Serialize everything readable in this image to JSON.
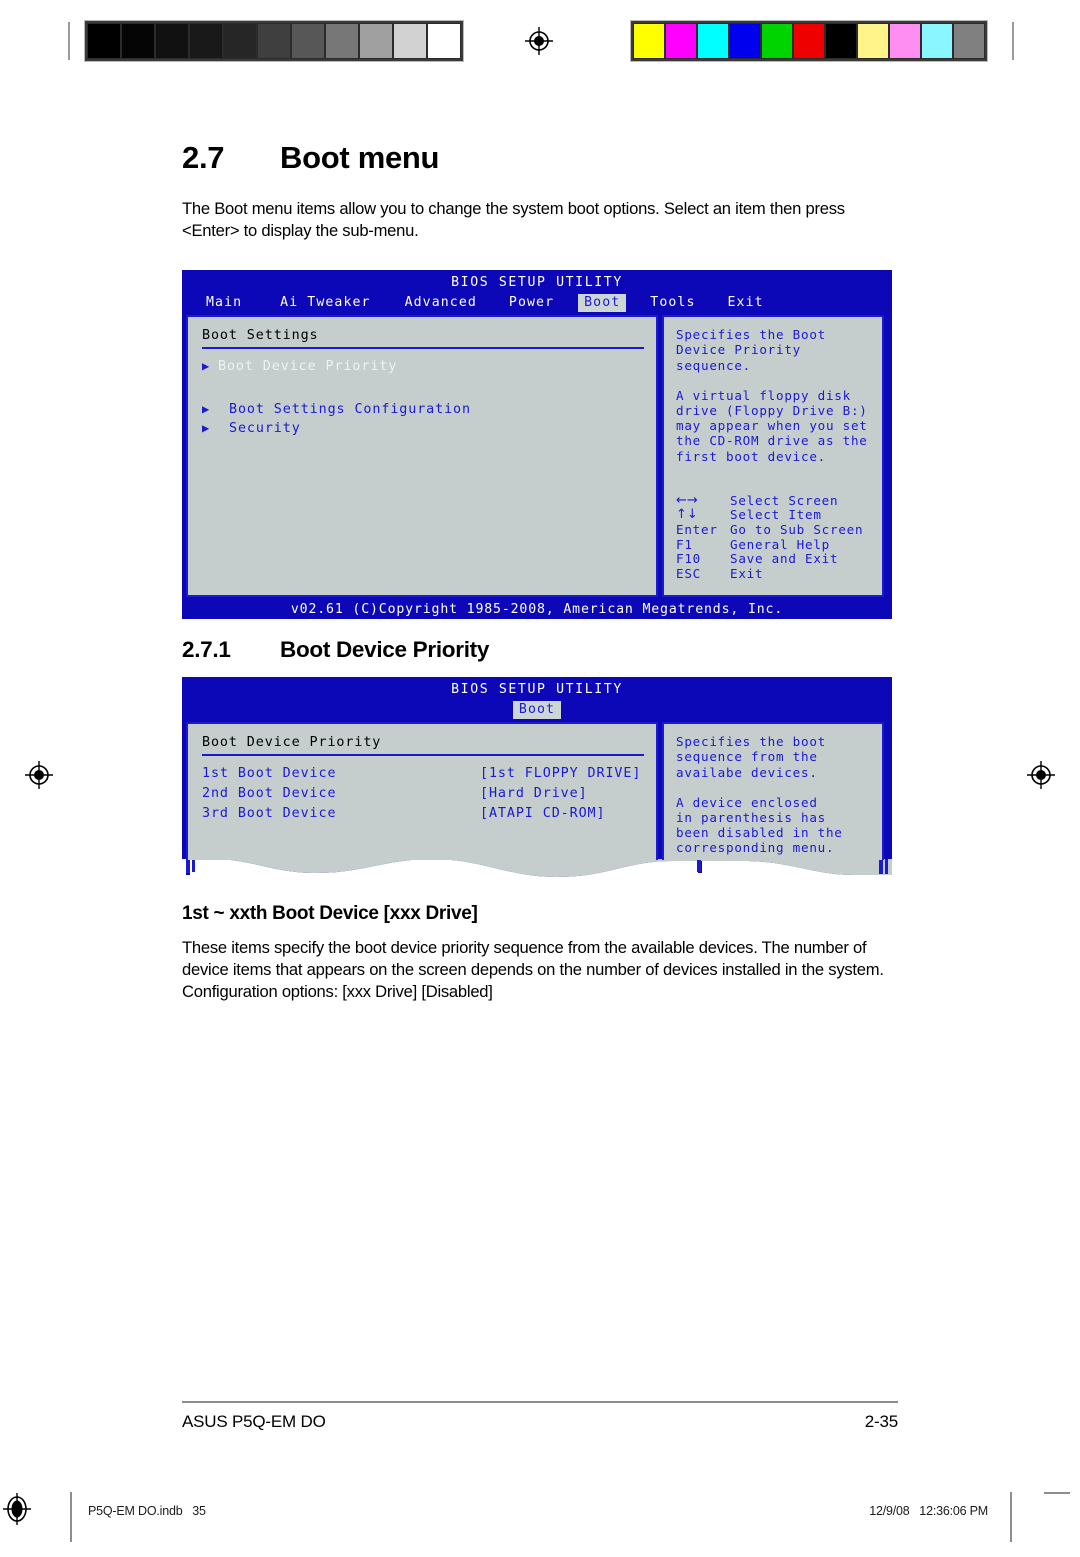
{
  "document": {
    "section": {
      "number": "2.7",
      "title": "Boot menu",
      "intro": "The Boot menu items allow you to change the system boot options. Select an item then press <Enter> to display the sub-menu."
    },
    "subsection": {
      "number": "2.7.1",
      "title": "Boot Device Priority"
    },
    "item": {
      "title": "1st ~ xxth Boot Device [xxx Drive]",
      "body": "These items specify the boot device priority sequence from the available devices. The number of device items that appears on the screen depends on the number of devices installed in the system. Configuration options: [xxx Drive] [Disabled]"
    },
    "footer": {
      "product": "ASUS P5Q-EM DO",
      "page_number": "2-35"
    },
    "print_footer": {
      "file": "P5Q-EM DO.indb   35",
      "timestamp": "12/9/08   12:36:06 PM",
      "registration_icon": "registration-target-icon"
    }
  },
  "calibration": {
    "grayscale_patches": [
      "#000000",
      "#050505",
      "#111111",
      "#191919",
      "#262626",
      "#3f3f3f",
      "#575757",
      "#777777",
      "#a0a0a0",
      "#d2d2d2",
      "#ffffff"
    ],
    "color_patches": [
      "#ffff00",
      "#ff00ff",
      "#00ffff",
      "#0000ee",
      "#00d400",
      "#ee0000",
      "#000000",
      "#fff48a",
      "#ff8ef2",
      "#8af6ff",
      "#808080"
    ],
    "registration_icon": "registration-target-icon"
  },
  "bios_main": {
    "title": "BIOS SETUP UTILITY",
    "menu": [
      {
        "label": "Main",
        "selected": false
      },
      {
        "label": "Ai Tweaker",
        "selected": false
      },
      {
        "label": "Advanced",
        "selected": false
      },
      {
        "label": "Power",
        "selected": false
      },
      {
        "label": "Boot",
        "selected": true
      },
      {
        "label": "Tools",
        "selected": false
      },
      {
        "label": "Exit",
        "selected": false
      }
    ],
    "panel_heading": "Boot Settings",
    "options": [
      {
        "label": "Boot Device Priority",
        "highlighted": true
      },
      {
        "label": "Boot Settings Configuration",
        "highlighted": false
      },
      {
        "label": "Security",
        "highlighted": false
      }
    ],
    "help_paragraph_1": "Specifies the Boot\nDevice Priority\nsequence.",
    "help_paragraph_2": "A virtual floppy disk\ndrive (Floppy Drive B:)\nmay appear when you set\nthe CD-ROM drive as the\nfirst boot device.",
    "key_help": [
      {
        "key": "←→",
        "action": "Select Screen",
        "glyph": true
      },
      {
        "key": "↑↓",
        "action": "Select Item",
        "glyph": true
      },
      {
        "key": "Enter",
        "action": "Go to Sub Screen",
        "glyph": false
      },
      {
        "key": "F1",
        "action": "General Help",
        "glyph": false
      },
      {
        "key": "F10",
        "action": "Save and Exit",
        "glyph": false
      },
      {
        "key": "ESC",
        "action": "Exit",
        "glyph": false
      }
    ],
    "copyright": "v02.61 (C)Copyright 1985-2008, American Megatrends, Inc."
  },
  "bios_sub": {
    "title": "BIOS SETUP UTILITY",
    "menu": [
      {
        "label": "Boot",
        "selected": true
      }
    ],
    "panel_heading": "Boot Device Priority",
    "devices": [
      {
        "name": "1st Boot Device",
        "value": "[1st FLOPPY DRIVE]"
      },
      {
        "name": "2nd Boot Device",
        "value": "[Hard Drive]"
      },
      {
        "name": "3rd Boot Device",
        "value": "[ATAPI CD-ROM]"
      }
    ],
    "help_paragraph_1": "Specifies the boot\nsequence from the\navailabe devices.",
    "help_paragraph_2": "A device enclosed\nin parenthesis has\nbeen disabled in the\ncorresponding menu."
  },
  "colors": {
    "bios_header_blue": "#0c07b7",
    "bios_panel_gray": "#c5cdcd",
    "bios_text_blue": "#1a1ad0",
    "page_rule_gray": "#8d8d8d"
  }
}
